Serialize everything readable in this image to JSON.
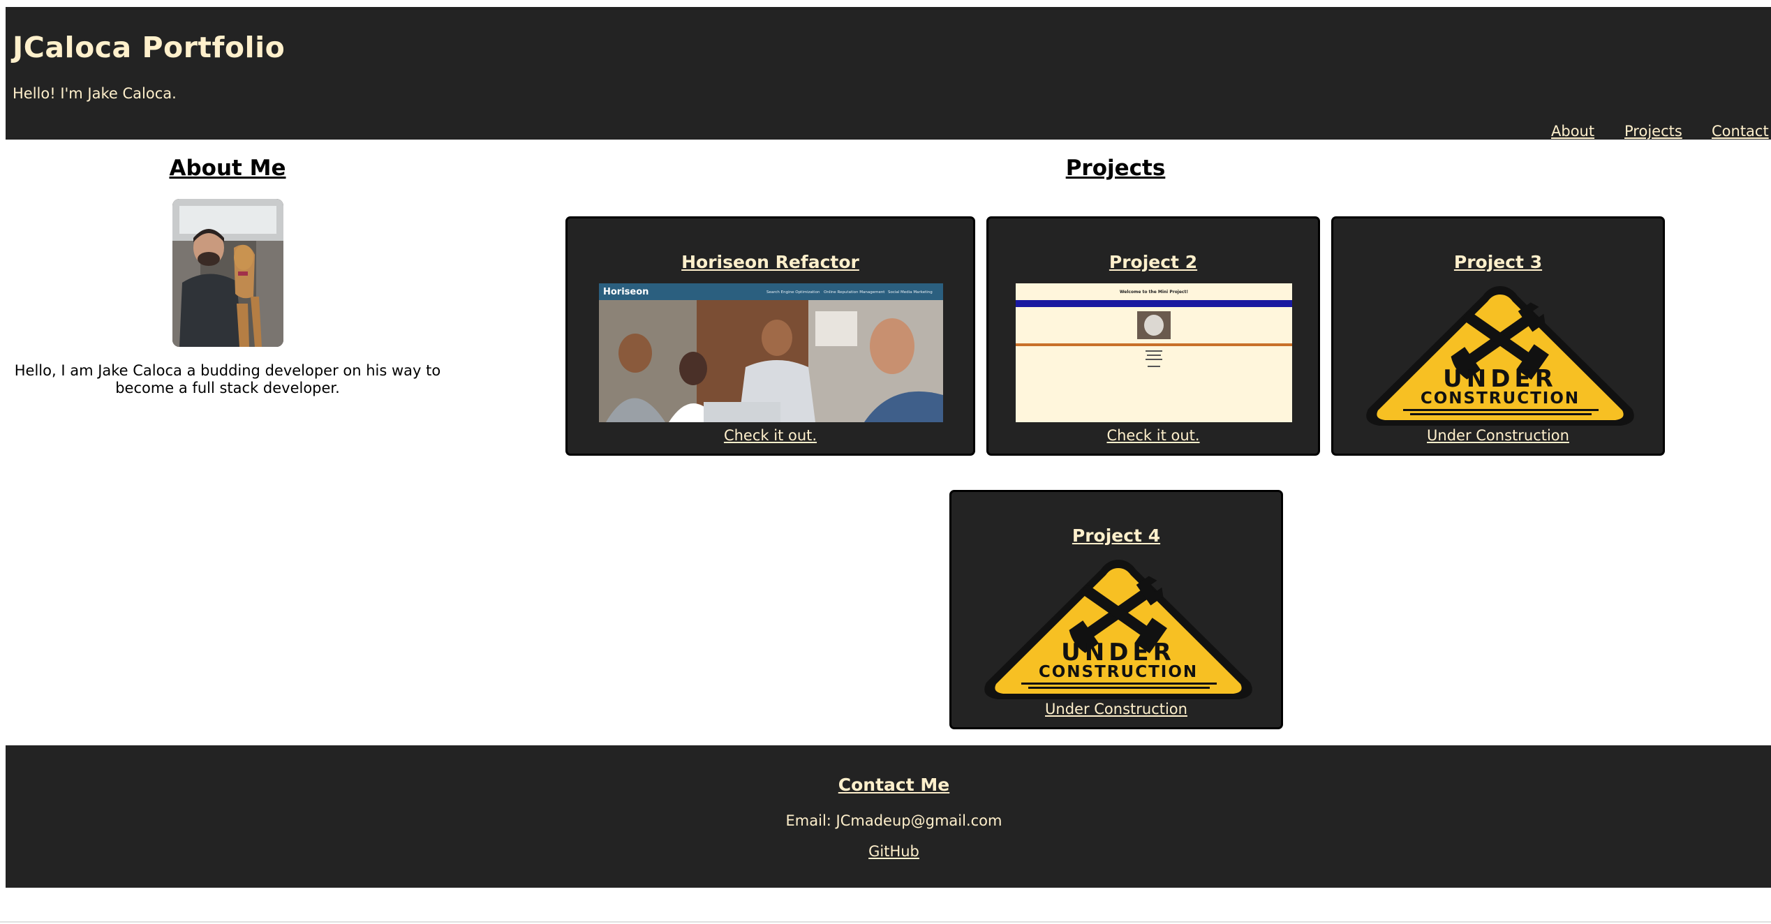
{
  "header": {
    "title": "JCaloca Portfolio",
    "subtitle": "Hello! I'm Jake Caloca."
  },
  "nav": {
    "items": [
      "About",
      "Projects",
      "Contact"
    ]
  },
  "about": {
    "heading": "About Me",
    "photo_icon": "profile-photo",
    "text": "Hello, I am Jake Caloca a budding developer on his way to become a full stack developer."
  },
  "projects": {
    "heading": "Projects",
    "cards": [
      {
        "title": "Horiseon Refactor",
        "link": "Check it out.",
        "thumb": "horiseon-screenshot",
        "brand": "Horiseon",
        "nav_links": [
          "Search Engine Optimization",
          "Online Reputation Management",
          "Social Media Marketing"
        ]
      },
      {
        "title": "Project 2",
        "link": "Check it out.",
        "thumb": "project2-screenshot",
        "heading_text": "Welcome to the Mini Project!"
      },
      {
        "title": "Project 3",
        "link": "Under Construction",
        "thumb": "under-construction-sign"
      },
      {
        "title": "Project 4",
        "link": "Under Construction",
        "thumb": "under-construction-sign"
      }
    ],
    "sign_text": [
      "UNDER",
      "CONSTRUCTION"
    ]
  },
  "footer": {
    "heading": "Contact Me",
    "email": "Email: JCmadeup@gmail.com",
    "github": "GitHub"
  },
  "colors": {
    "header_bg": "#232323",
    "accent_text": "#fff0cc",
    "sign_yellow": "#f7c023",
    "horiseon_bar": "#2b5f7f"
  }
}
